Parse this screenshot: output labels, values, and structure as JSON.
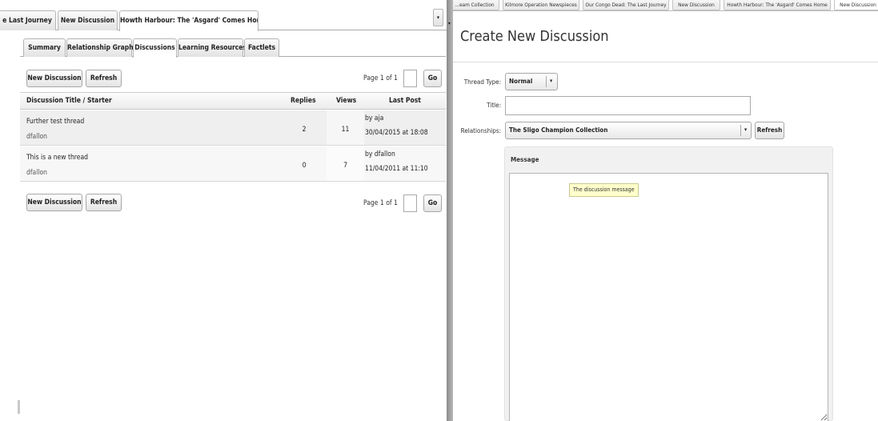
{
  "left_pane": {
    "doc_tabs": [
      {
        "label": "e Last Journey",
        "active": false
      },
      {
        "label": "New Discussion",
        "active": false
      },
      {
        "label": "Howth Harbour: The 'Asgard' Comes Home",
        "active": true
      }
    ],
    "doc_tabs_menu_icon": "▾",
    "sub_tabs": [
      {
        "label": "Summary",
        "active": false
      },
      {
        "label": "Relationship Graph",
        "active": false
      },
      {
        "label": "Discussions",
        "active": true
      },
      {
        "label": "Learning Resources",
        "active": false
      },
      {
        "label": "Factlets",
        "active": false
      }
    ],
    "toolbar": {
      "new_discussion_label": "New Discussion",
      "refresh_label": "Refresh",
      "page_text": "Page 1 of 1",
      "page_input_value": "",
      "go_label": "Go"
    },
    "grid": {
      "headers": {
        "title": "Discussion Title / Starter",
        "replies": "Replies",
        "views": "Views",
        "last_post": "Last Post"
      },
      "rows": [
        {
          "title": "Further test thread",
          "starter": "dfallon",
          "replies": "2",
          "views": "11",
          "last_post_by": "by aja",
          "last_post_date": "30/04/2015 at 18:08"
        },
        {
          "title": "This is a new thread",
          "starter": "dfallon",
          "replies": "0",
          "views": "7",
          "last_post_by": "by dfallon",
          "last_post_date": "11/04/2011 at 11:10"
        }
      ]
    }
  },
  "divider": {
    "collapse_icon": "▾"
  },
  "right_pane": {
    "tabs": [
      {
        "label": "...eam Collection",
        "active": false
      },
      {
        "label": "Kilmore Operation Newspieces",
        "active": false
      },
      {
        "label": "Our Congo Dead: The Last Journey",
        "active": false
      },
      {
        "label": "New Discussion",
        "active": false
      },
      {
        "label": "Howth Harbour: The 'Asgard' Comes Home",
        "active": false
      },
      {
        "label": "New Discussion",
        "active": true
      }
    ],
    "heading": "Create New Discussion",
    "form": {
      "thread_type_label": "Thread Type:",
      "thread_type_value": "Normal",
      "title_label": "Title:",
      "title_value": "",
      "relationships_label": "Relationships:",
      "relationships_value": "The Sligo Champion Collection",
      "refresh_label": "Refresh",
      "message_label": "Message",
      "message_value": "",
      "message_tooltip": "The discussion message"
    },
    "dropdown_arrow": "▾"
  }
}
